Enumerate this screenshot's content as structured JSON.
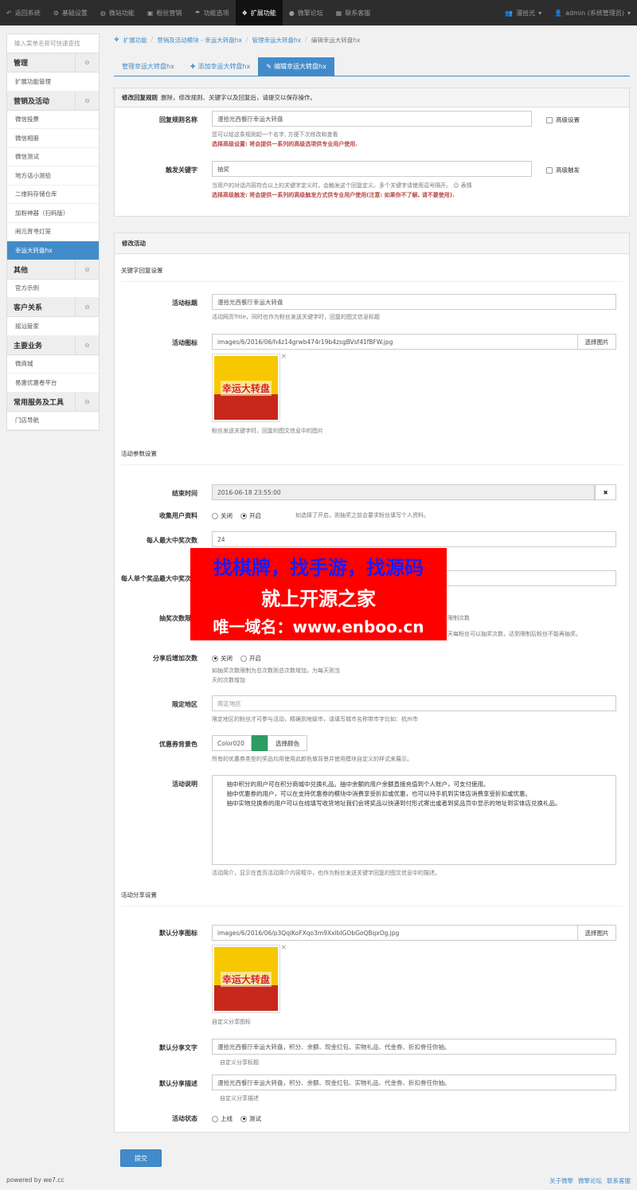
{
  "topnav": {
    "items": [
      {
        "label": "返回系统",
        "icon": "undo-icon"
      },
      {
        "label": "基础设置",
        "icon": "gear-icon"
      },
      {
        "label": "微站功能",
        "icon": "globe-icon"
      },
      {
        "label": "粉丝营销",
        "icon": "briefcase-icon"
      },
      {
        "label": "功能选项",
        "icon": "umbrella-icon"
      },
      {
        "label": "扩展功能",
        "icon": "cubes-icon"
      },
      {
        "label": "微擎论坛",
        "icon": "comment-icon"
      },
      {
        "label": "联系客服",
        "icon": "building-icon"
      }
    ],
    "user_group": "漫拾光",
    "user_name": "admin (系统管理员)"
  },
  "sidebar": {
    "search_placeholder": "输入菜单名称可快速查找",
    "groups": [
      {
        "title": "管理",
        "links": [
          "扩展功能管理"
        ]
      },
      {
        "title": "营销及活动",
        "links": [
          "微信投票",
          "微信相册",
          "微信测试",
          "地方话小测验",
          "二维码存储仓库",
          "加粉神器（扫码版）",
          "闹元宵寻灯笼",
          "幸运大转盘hx"
        ]
      },
      {
        "title": "其他",
        "links": [
          "官方示例"
        ]
      },
      {
        "title": "客户关系",
        "links": [
          "摇汕管家"
        ]
      },
      {
        "title": "主要业务",
        "links": [
          "微商城",
          "易惠优惠卷平台"
        ]
      },
      {
        "title": "常用服务及工具",
        "links": [
          "门店导航"
        ]
      }
    ]
  },
  "breadcrumb": {
    "items": [
      "扩展功能",
      "营销及活动模块 - 幸运大转盘hx",
      "管理幸运大转盘hx"
    ],
    "current": "编辑幸运大转盘hx"
  },
  "tabs": [
    "管理幸运大转盘hx",
    "添加幸运大转盘hx",
    "编辑幸运大转盘hx"
  ],
  "rule_panel": {
    "heading_bold": "修改回复规则",
    "heading_rest": "删除，修改规则、关键字以及回复后，请提交以保存操作。",
    "name_label": "回复规则名称",
    "name_value": "漫拾光西餐厅幸运大转盘",
    "name_help": "您可以给这条规则起一个名字, 方便下次修改和查看",
    "name_red": "选择高级设置: 将会提供一系列的高级选项供专业用户使用.",
    "advanced_label": "高级设置",
    "keyword_label": "触发关键字",
    "keyword_value": "抽奖",
    "keyword_help": "当用户的对话内容符合以上的关键字定义时，会触发这个回复定义。多个关键字请使用逗号隔开。",
    "emoji_label": "表情",
    "keyword_red": "选择高级触发: 将会提供一系列的高级触发方式供专业用户使用(注意: 如果你不了解, 请不要使用).",
    "adv_trigger_label": "高级触发"
  },
  "activity_panel": {
    "heading": "修改活动",
    "section_keyword": "关键字回复设置",
    "title_label": "活动标题",
    "title_value": "漫拾光西餐厅幸运大转盘",
    "title_help": "活动网页Title，同时也作为粉丝发送关键字时，回复的图文信息标题",
    "icon_label": "活动图标",
    "icon_value": "images/6/2016/06/h4z14grwb474r19b4zsgBVsf41fBFW.jpg",
    "choose_image": "选择图片",
    "thumb_text": "幸运大转盘",
    "icon_help": "粉丝发送关键字时，回复的图文信息中的图片",
    "section_params": "活动参数设置",
    "end_label": "结束时间",
    "end_value": "2016-06-18 23:55:00",
    "clear_btn": "✖",
    "collect_label": "收集用户资料",
    "off": "关闭",
    "on": "开启",
    "collect_help": "如选择了开启，则抽奖之前会要求粉丝填写个人资料。",
    "max_win_label": "每人最大中奖次数",
    "max_win_value": "24",
    "max_item_label": "每人单个奖品最大中奖次数",
    "limit_label": "抽奖次数限制",
    "limit_help_right": "限制次数",
    "limit_help2": "天每粉丝可以抽奖次数，达到限制后粉丝不能再抽奖。",
    "share_add_label": "分享后增加次数",
    "share_add_help1": "如抽奖次数限制为总次数则总次数增加，为每天则当",
    "share_add_help2": "天的次数增加",
    "region_label": "限定地区",
    "region_placeholder": "限定地区",
    "region_help": "限定地区的粉丝才可参与活动，精确到地级市，请填写城市名称带市字比如：杭州市",
    "bg_label": "优惠券背景色",
    "bg_value": "Color020",
    "bg_color": "#2e9b62",
    "choose_color": "选择颜色",
    "bg_help": "所有的优惠券类型的奖品均用使用此颜色做背景并使用模块自定义的样式来展示。",
    "desc_label": "活动说明",
    "desc_value": "    抽中积分的用户可在积分商城中兑换礼品。抽中余额的用户余额直接充值到个人账户，可支付使用。\n    抽中优惠券的用户，可以在支持优惠券的模块中消费享受折扣或优惠，也可以持手机到实体店消费享受折扣或优惠。\n    抽中实物兑换券的用户可以在线填写收货地址我们会将奖品以快递到付形式寄出或者到奖品页中显示的地址到实体店兑换礼品。",
    "desc_help": "活动简介，显示在首页活动简介内容框中，也作为粉丝发送关键字回复的图文信息中的描述。",
    "section_share": "活动分享设置",
    "share_icon_label": "默认分享图标",
    "share_icon_value": "images/6/2016/06/p3QqIKoFXqo3m9XxlbIGObGoQBqxOg.jpg",
    "share_icon_help": "自定义分享图标",
    "share_text_label": "默认分享文字",
    "share_text_value": "漫拾光西餐厅幸运大转盘，积分、余额、现金红包、实物礼品、代金券、折扣劵任你抽。",
    "share_text_help": "自定义分享标题",
    "share_desc_label": "默认分享描述",
    "share_desc_value": "漫拾光西餐厅幸运大转盘，积分、余额、现金红包、实物礼品、代金券、折扣劵任你抽。",
    "share_desc_help": "自定义分享描述",
    "status_label": "活动状态",
    "status_online": "上线",
    "status_test": "测试"
  },
  "submit_label": "提交",
  "footer": {
    "powered": "powered by we7.cc",
    "links": [
      "关于微擎",
      "微擎论坛",
      "联系客服"
    ]
  },
  "watermark": {
    "line1": "找棋牌，找手游，找源码",
    "line2": "就上开源之家",
    "line3": "唯一域名：www.enboo.cn"
  }
}
